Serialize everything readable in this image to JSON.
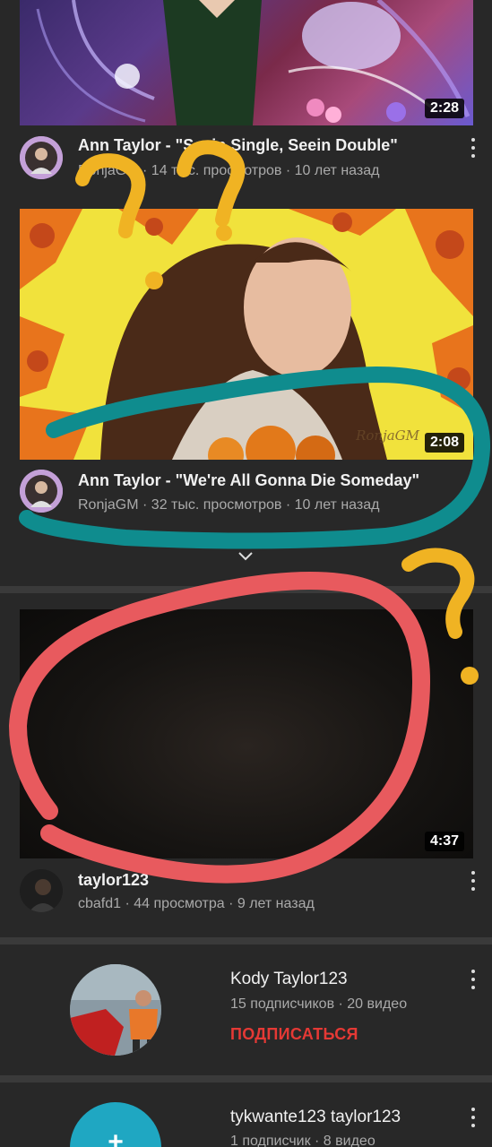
{
  "videos": [
    {
      "title": "Ann Taylor - \"Seein Single, Seein Double\"",
      "channel": "RonjaGM",
      "meta": "RonjaGM · 14 тыс. просмотров · 10 лет назад",
      "duration": "2:28"
    },
    {
      "title": "Ann Taylor - \"We're All Gonna Die Someday\"",
      "channel": "RonjaGM",
      "meta": "RonjaGM · 32 тыс. просмотров · 10 лет назад",
      "duration": "2:08",
      "watermark": "RonjaGM"
    },
    {
      "title": "taylor123",
      "channel": "cbafd1",
      "meta": "cbafd1 · 44 просмотра · 9 лет назад",
      "duration": "4:37"
    }
  ],
  "channels": [
    {
      "name": "Kody Taylor123",
      "stats": "15 подписчиков · 20 видео",
      "subscribe_label": "ПОДПИСАТЬСЯ"
    },
    {
      "name": "tykwante123 taylor123",
      "stats": "1 подписчик · 8 видео",
      "avatar_letter": "+"
    }
  ],
  "icons": {
    "more": "more-vert-icon",
    "expand": "chevron-down-icon"
  },
  "colors": {
    "background": "#282828",
    "subscribe": "#e53935",
    "annotation_teal": "#0f8c8e",
    "annotation_red": "#e85a5e",
    "annotation_yellow": "#f0b323",
    "avatar_teal": "#1fa7c2"
  }
}
